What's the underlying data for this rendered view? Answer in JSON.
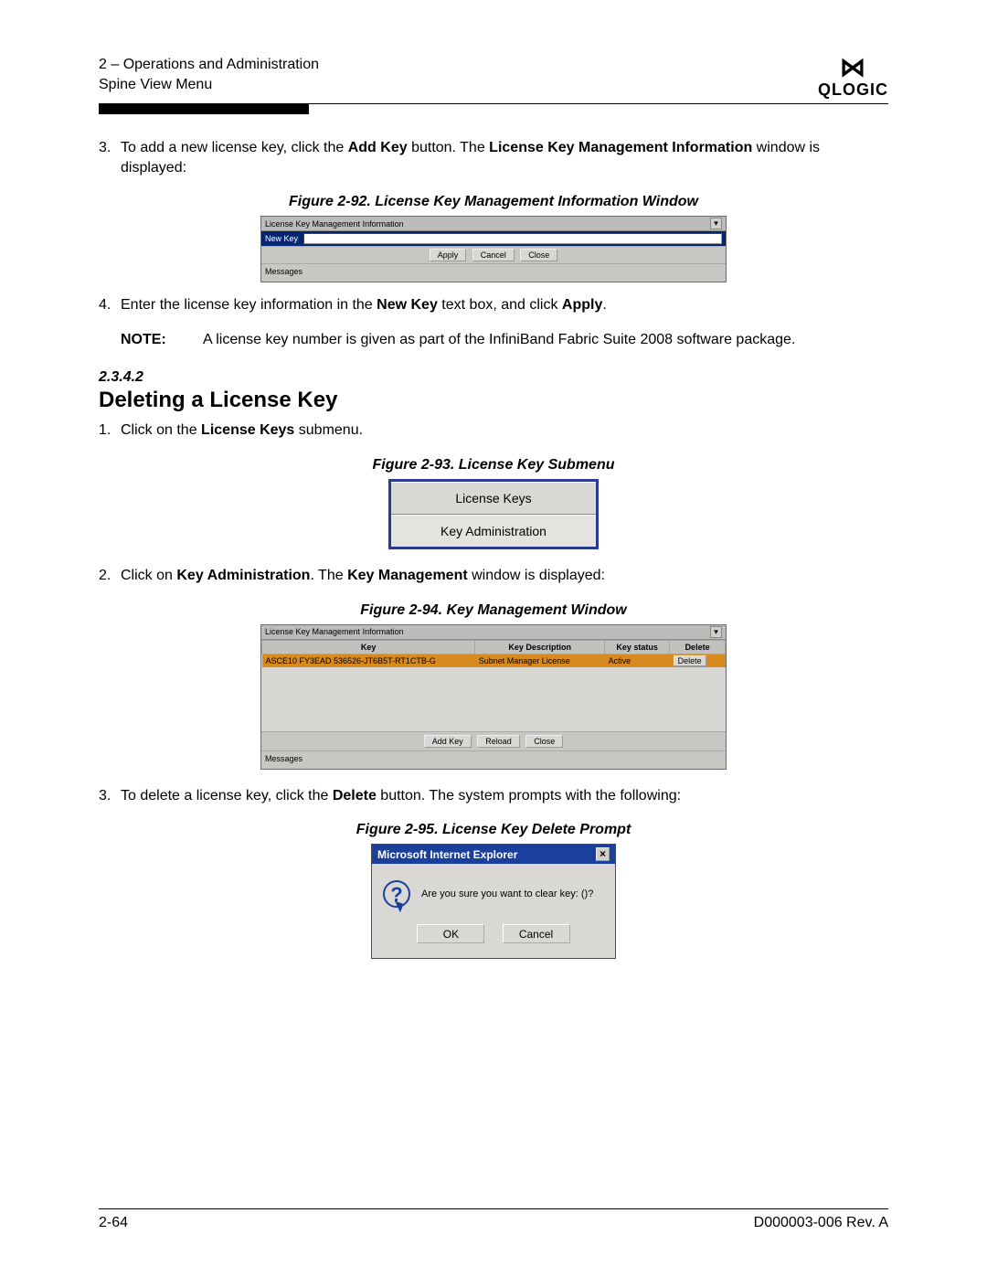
{
  "header": {
    "line1": "2 – Operations and Administration",
    "line2": "Spine View Menu",
    "brand": "QLOGIC"
  },
  "step3": {
    "num": "3.",
    "pre": "To add a new license key, click the ",
    "addkey": "Add Key",
    "mid": " button. The ",
    "lkmi1": "License Key Management Information",
    "post": " window is displayed:"
  },
  "fig92": {
    "caption": "Figure 2-92. License Key Management Information Window",
    "title": "License Key Management Information",
    "newkey": "New Key",
    "apply": "Apply",
    "cancel": "Cancel",
    "close": "Close",
    "messages": "Messages"
  },
  "step4": {
    "num": "4.",
    "pre": "Enter the license key information in the ",
    "newkey": "New Key",
    "mid": " text box, and click ",
    "apply": "Apply",
    "post": "."
  },
  "note": {
    "label": "NOTE:",
    "text": "A license key number is given as part of the InfiniBand Fabric Suite 2008 software package."
  },
  "sec": {
    "num": "2.3.4.2",
    "title": "Deleting a License Key"
  },
  "d_step1": {
    "num": "1.",
    "pre": "Click on the ",
    "b": "License Keys",
    "post": " submenu."
  },
  "fig93": {
    "caption": "Figure 2-93. License Key Submenu",
    "item1": "License Keys",
    "item2": "Key Administration"
  },
  "d_step2": {
    "num": "2.",
    "pre": "Click on ",
    "b1": "Key Administration",
    "mid": ". The ",
    "b2": "Key Management",
    "post": " window is displayed:"
  },
  "fig94": {
    "caption": "Figure 2-94. Key Management Window",
    "title": "License Key Management Information",
    "h_key": "Key",
    "h_desc": "Key Description",
    "h_status": "Key status",
    "h_delete": "Delete",
    "row_key": "ASCE10 FY3EAD 536526-JT6B5T-RT1CTB-G",
    "row_desc": "Subnet Manager License",
    "row_status": "Active",
    "row_del": "Delete",
    "addkey": "Add Key",
    "reload": "Reload",
    "close": "Close",
    "messages": "Messages"
  },
  "d_step3": {
    "num": "3.",
    "pre": "To delete a license key, click the ",
    "b": "Delete",
    "post": " button. The system prompts with the following:"
  },
  "fig95": {
    "caption": "Figure 2-95. License Key Delete Prompt",
    "title": "Microsoft Internet Explorer",
    "msg": "Are you sure you want to clear key: ()?",
    "ok": "OK",
    "cancel": "Cancel"
  },
  "footer": {
    "left": "2-64",
    "right": "D000003-006 Rev. A"
  }
}
